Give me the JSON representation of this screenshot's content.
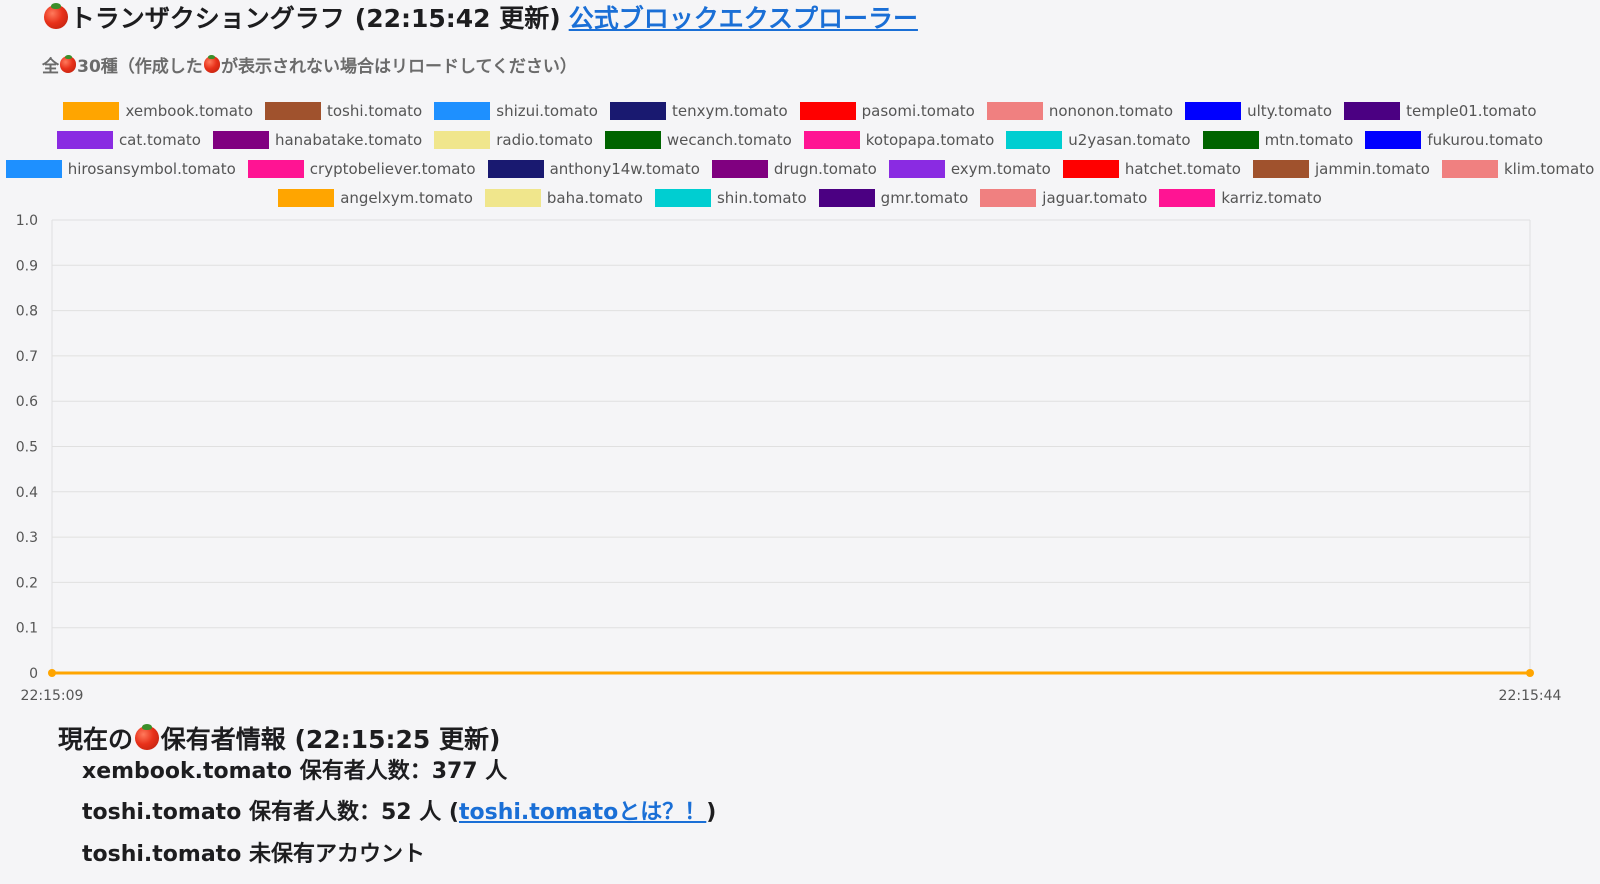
{
  "header": {
    "title_prefix": "トランザクショングラフ",
    "update_time": "(22:15:42 更新)",
    "explorer_link": "公式ブロックエクスプローラー"
  },
  "subtitle": {
    "prefix": "全",
    "suffix": "30種（作成した",
    "suffix2": "が表示されない場合はリロードしてください）"
  },
  "legend": {
    "rows": [
      [
        {
          "label": "xembook.tomato",
          "color": "#FFA500"
        },
        {
          "label": "toshi.tomato",
          "color": "#A0522D"
        },
        {
          "label": "shizui.tomato",
          "color": "#1E90FF"
        },
        {
          "label": "tenxym.tomato",
          "color": "#191970"
        },
        {
          "label": "pasomi.tomato",
          "color": "#FF0000"
        },
        {
          "label": "nononon.tomato",
          "color": "#F08080"
        },
        {
          "label": "ulty.tomato",
          "color": "#0000FF"
        },
        {
          "label": "temple01.tomato",
          "color": "#4B0082"
        }
      ],
      [
        {
          "label": "cat.tomato",
          "color": "#8A2BE2"
        },
        {
          "label": "hanabatake.tomato",
          "color": "#800080"
        },
        {
          "label": "radio.tomato",
          "color": "#F0E68C"
        },
        {
          "label": "wecanch.tomato",
          "color": "#006400"
        },
        {
          "label": "kotopapa.tomato",
          "color": "#FF1493"
        },
        {
          "label": "u2yasan.tomato",
          "color": "#00CED1"
        },
        {
          "label": "mtn.tomato",
          "color": "#006400"
        },
        {
          "label": "fukurou.tomato",
          "color": "#0000FF"
        }
      ],
      [
        {
          "label": "hirosansymbol.tomato",
          "color": "#1E90FF"
        },
        {
          "label": "cryptobeliever.tomato",
          "color": "#FF1493"
        },
        {
          "label": "anthony14w.tomato",
          "color": "#191970"
        },
        {
          "label": "drugn.tomato",
          "color": "#800080"
        },
        {
          "label": "exym.tomato",
          "color": "#8A2BE2"
        },
        {
          "label": "hatchet.tomato",
          "color": "#FF0000"
        },
        {
          "label": "jammin.tomato",
          "color": "#A0522D"
        },
        {
          "label": "klim.tomato",
          "color": "#F08080"
        }
      ],
      [
        {
          "label": "angelxym.tomato",
          "color": "#FFA500"
        },
        {
          "label": "baha.tomato",
          "color": "#F0E68C"
        },
        {
          "label": "shin.tomato",
          "color": "#00CED1"
        },
        {
          "label": "gmr.tomato",
          "color": "#4B0082"
        },
        {
          "label": "jaguar.tomato",
          "color": "#F08080"
        },
        {
          "label": "karriz.tomato",
          "color": "#FF1493"
        }
      ]
    ]
  },
  "chart_data": {
    "type": "line",
    "x": [
      "22:15:09",
      "22:15:44"
    ],
    "xticks": [
      "22:15:09",
      "22:15:44"
    ],
    "yticks": [
      "1.0",
      "0.9",
      "0.8",
      "0.7",
      "0.6",
      "0.5",
      "0.4",
      "0.3",
      "0.2",
      "0.1",
      "0"
    ],
    "ylim": [
      0,
      1
    ],
    "grid": true,
    "legend_position": "top",
    "series": [
      {
        "name": "xembook.tomato",
        "values": [
          0,
          0
        ],
        "color": "#FFA500"
      }
    ]
  },
  "holders": {
    "title_prefix": "現在の",
    "title_suffix": "保有者情報 (22:15:25 更新)",
    "line1": "xembook.tomato 保有者人数：377 人",
    "line2_text": "toshi.tomato 保有者人数：52 人 (",
    "line2_link": "toshi.tomatoとは？！",
    "line2_close": ")",
    "line3": "toshi.tomato 未保有アカウント"
  }
}
